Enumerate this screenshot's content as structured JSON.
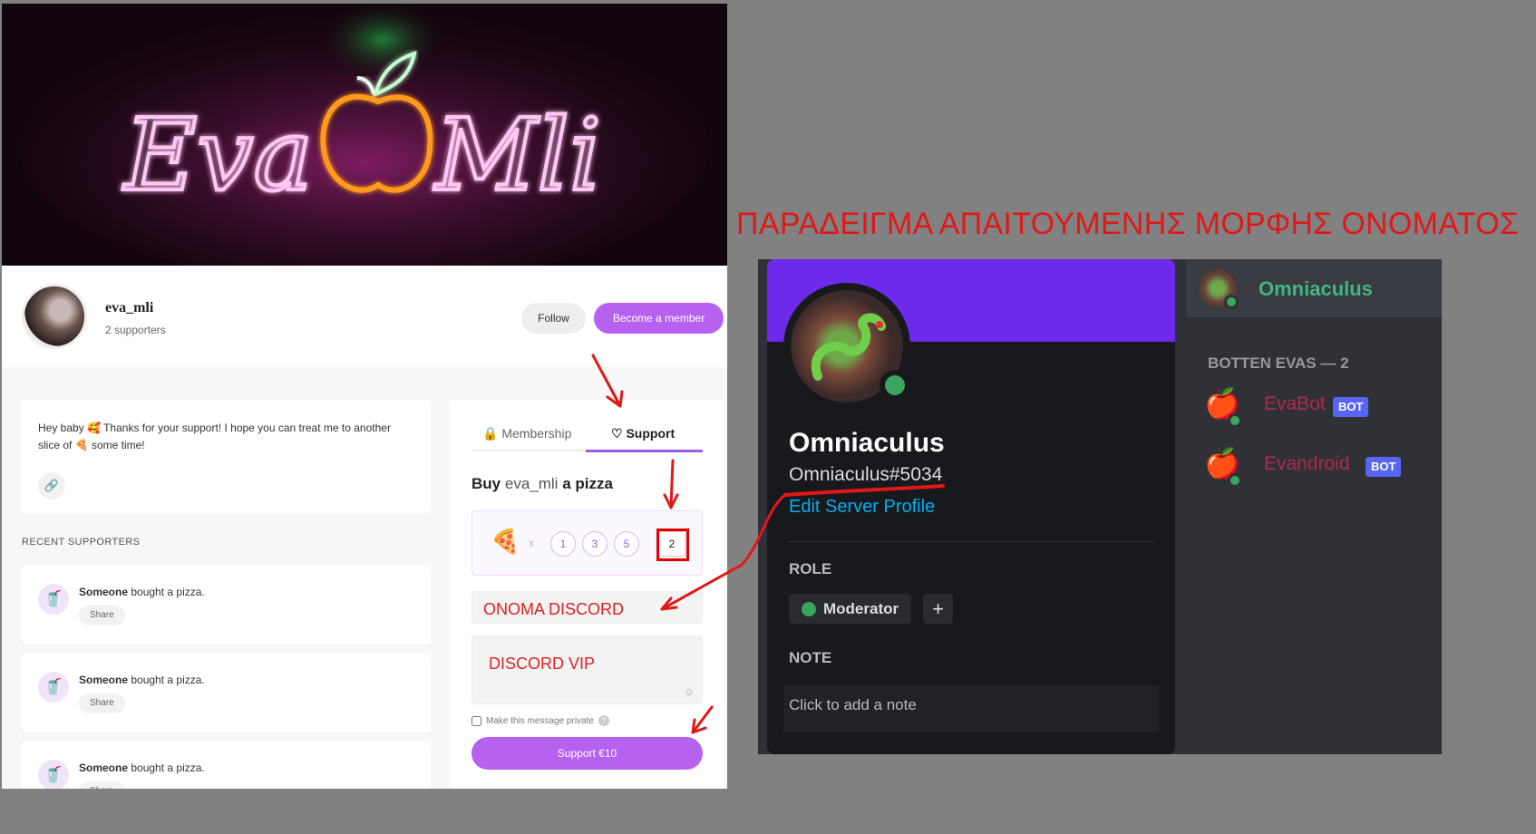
{
  "heading": "ΠΑΡΑΔΕΙΓΜΑ ΑΠΑΙΤΟΥΜΕΝΗΣ ΜΟΡΦΗΣ ΟΝΟΜΑΤΟΣ",
  "bmc": {
    "banner_text": "Eva Mli",
    "creator_name": "eva_mli",
    "supporters": "2 supporters",
    "follow_label": "Follow",
    "member_label": "Become a member",
    "thanks_message": "Hey baby 🥰 Thanks for your support! I hope you can treat me to another slice of 🍕 some time!",
    "recent_title": "RECENT SUPPORTERS",
    "supporters_list": [
      {
        "name": "Someone",
        "action": "bought a pizza.",
        "share": "Share"
      },
      {
        "name": "Someone",
        "action": "bought a pizza.",
        "share": "Share"
      },
      {
        "name": "Someone",
        "action": "bought a pizza.",
        "share": "Share"
      }
    ],
    "tabs": {
      "membership": "Membership",
      "support": "Support"
    },
    "buy_prefix": "Buy",
    "buy_name": "eva_mli",
    "buy_suffix": "a pizza",
    "times": "x",
    "quantities": [
      "1",
      "3",
      "5"
    ],
    "custom_qty": "2",
    "name_field": "ONOMA DISCORD",
    "message_field": "DISCORD VIP",
    "private_label": "Make this message private",
    "support_button": "Support €10"
  },
  "discord": {
    "display_name": "Omniaculus",
    "tag": "Omniaculus#5034",
    "edit_profile": "Edit Server Profile",
    "role_title": "ROLE",
    "role": "Moderator",
    "role_add": "+",
    "note_title": "NOTE",
    "note_placeholder": "Click to add a note",
    "member_top": "Omniaculus",
    "group_title": "BOTTEN EVAS — 2",
    "bots": [
      {
        "name": "EvaBot",
        "tag": "BOT"
      },
      {
        "name": "Evandroid",
        "tag": "BOT"
      }
    ]
  },
  "colors": {
    "accent_purple": "#b761f1",
    "discord_banner": "#6e2aeb",
    "annotation_red": "#e01818",
    "online_green": "#3ba55d"
  }
}
